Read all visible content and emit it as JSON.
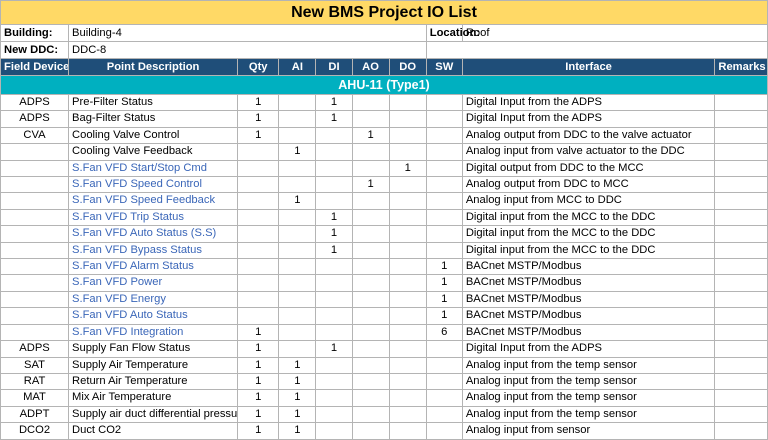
{
  "title": "New BMS Project IO List",
  "info": {
    "building_label": "Building:",
    "building_value": "Building-4",
    "location_label": "Location:",
    "location_value": "Roof",
    "ddc_label": "New DDC:",
    "ddc_value": "DDC-8"
  },
  "headers": [
    "Field Device",
    "Point Description",
    "Qty",
    "AI",
    "DI",
    "AO",
    "DO",
    "SW",
    "Interface",
    "Remarks"
  ],
  "group_title": "AHU-11 (Type1)",
  "rows": [
    {
      "device": "ADPS",
      "desc": "Pre-Filter Status",
      "qty": "1",
      "ai": "",
      "di": "1",
      "ao": "",
      "do": "",
      "sw": "",
      "interface": "Digital Input from the ADPS",
      "remarks": "",
      "blue": false
    },
    {
      "device": "ADPS",
      "desc": "Bag-Filter Status",
      "qty": "1",
      "ai": "",
      "di": "1",
      "ao": "",
      "do": "",
      "sw": "",
      "interface": "Digital Input from the ADPS",
      "remarks": "",
      "blue": false
    },
    {
      "device": "CVA",
      "desc": "Cooling Valve Control",
      "qty": "1",
      "ai": "",
      "di": "",
      "ao": "1",
      "do": "",
      "sw": "",
      "interface": "Analog output from DDC to the valve actuator",
      "remarks": "",
      "blue": false
    },
    {
      "device": "",
      "desc": "Cooling Valve Feedback",
      "qty": "",
      "ai": "1",
      "di": "",
      "ao": "",
      "do": "",
      "sw": "",
      "interface": "Analog input from valve actuator to the DDC",
      "remarks": "",
      "blue": false
    },
    {
      "device": "",
      "desc": "S.Fan VFD Start/Stop Cmd",
      "qty": "",
      "ai": "",
      "di": "",
      "ao": "",
      "do": "1",
      "sw": "",
      "interface": "Digital output from DDC to the MCC",
      "remarks": "",
      "blue": true
    },
    {
      "device": "",
      "desc": "S.Fan VFD Speed Control",
      "qty": "",
      "ai": "",
      "di": "",
      "ao": "1",
      "do": "",
      "sw": "",
      "interface": "Analog output from DDC to MCC",
      "remarks": "",
      "blue": true
    },
    {
      "device": "",
      "desc": "S.Fan VFD Speed Feedback",
      "qty": "",
      "ai": "1",
      "di": "",
      "ao": "",
      "do": "",
      "sw": "",
      "interface": "Analog input from MCC to DDC",
      "remarks": "",
      "blue": true
    },
    {
      "device": "",
      "desc": "S.Fan VFD Trip Status",
      "qty": "",
      "ai": "",
      "di": "1",
      "ao": "",
      "do": "",
      "sw": "",
      "interface": "Digital input from the MCC to the DDC",
      "remarks": "",
      "blue": true
    },
    {
      "device": "",
      "desc": "S.Fan VFD Auto Status (S.S)",
      "qty": "",
      "ai": "",
      "di": "1",
      "ao": "",
      "do": "",
      "sw": "",
      "interface": "Digital input from the MCC to the DDC",
      "remarks": "",
      "blue": true
    },
    {
      "device": "",
      "desc": "S.Fan VFD Bypass Status",
      "qty": "",
      "ai": "",
      "di": "1",
      "ao": "",
      "do": "",
      "sw": "",
      "interface": "Digital input from the MCC to the DDC",
      "remarks": "",
      "blue": true
    },
    {
      "device": "",
      "desc": "S.Fan VFD Alarm Status",
      "qty": "",
      "ai": "",
      "di": "",
      "ao": "",
      "do": "",
      "sw": "1",
      "interface": "BACnet MSTP/Modbus",
      "remarks": "",
      "blue": true
    },
    {
      "device": "",
      "desc": "S.Fan VFD Power",
      "qty": "",
      "ai": "",
      "di": "",
      "ao": "",
      "do": "",
      "sw": "1",
      "interface": "BACnet MSTP/Modbus",
      "remarks": "",
      "blue": true
    },
    {
      "device": "",
      "desc": "S.Fan VFD Energy",
      "qty": "",
      "ai": "",
      "di": "",
      "ao": "",
      "do": "",
      "sw": "1",
      "interface": "BACnet MSTP/Modbus",
      "remarks": "",
      "blue": true
    },
    {
      "device": "",
      "desc": "S.Fan VFD Auto Status",
      "qty": "",
      "ai": "",
      "di": "",
      "ao": "",
      "do": "",
      "sw": "1",
      "interface": "BACnet MSTP/Modbus",
      "remarks": "",
      "blue": true
    },
    {
      "device": "",
      "desc": "S.Fan VFD Integration",
      "qty": "1",
      "ai": "",
      "di": "",
      "ao": "",
      "do": "",
      "sw": "6",
      "interface": "BACnet MSTP/Modbus",
      "remarks": "",
      "blue": true
    },
    {
      "device": "ADPS",
      "desc": "Supply Fan Flow Status",
      "qty": "1",
      "ai": "",
      "di": "1",
      "ao": "",
      "do": "",
      "sw": "",
      "interface": "Digital Input from the ADPS",
      "remarks": "",
      "blue": false
    },
    {
      "device": "SAT",
      "desc": "Supply Air Temperature",
      "qty": "1",
      "ai": "1",
      "di": "",
      "ao": "",
      "do": "",
      "sw": "",
      "interface": "Analog input from the temp sensor",
      "remarks": "",
      "blue": false
    },
    {
      "device": "RAT",
      "desc": "Return Air Temperature",
      "qty": "1",
      "ai": "1",
      "di": "",
      "ao": "",
      "do": "",
      "sw": "",
      "interface": "Analog input from the temp sensor",
      "remarks": "",
      "blue": false
    },
    {
      "device": "MAT",
      "desc": "Mix Air Temperature",
      "qty": "1",
      "ai": "1",
      "di": "",
      "ao": "",
      "do": "",
      "sw": "",
      "interface": "Analog input from the temp sensor",
      "remarks": "",
      "blue": false
    },
    {
      "device": "ADPT",
      "desc": "Supply air duct differential pressure",
      "qty": "1",
      "ai": "1",
      "di": "",
      "ao": "",
      "do": "",
      "sw": "",
      "interface": "Analog input from the temp sensor",
      "remarks": "",
      "blue": false
    },
    {
      "device": "DCO2",
      "desc": "Duct CO2",
      "qty": "1",
      "ai": "1",
      "di": "",
      "ao": "",
      "do": "",
      "sw": "",
      "interface": "Analog input from sensor",
      "remarks": "",
      "blue": false
    }
  ]
}
